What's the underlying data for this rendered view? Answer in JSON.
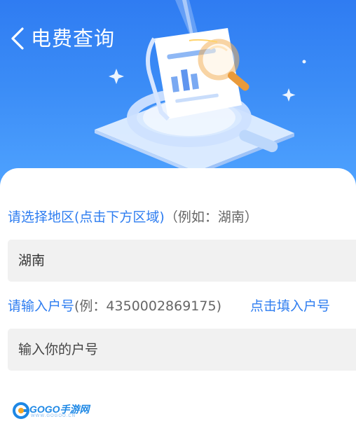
{
  "header": {
    "title": "电费查询",
    "back_icon": "chevron-left-icon",
    "hero_icon": "bill-magnifier-illustration"
  },
  "form": {
    "region_label": "请选择地区(点击下方区域)",
    "region_example": "（例如：湖南）",
    "region_value": "湖南",
    "account_label": "请输入户号",
    "account_example": "(例：4350002869175)",
    "account_fill_link": "点击填入户号",
    "account_placeholder": "输入你的户号"
  },
  "watermark": {
    "brand": "GOGO手游网",
    "url": "WWW.GOGOO.CN"
  },
  "colors": {
    "accent": "#2e7df0",
    "header_top": "#2f7cf2",
    "header_bottom": "#4fa3ff",
    "field_bg": "#f1f1f1"
  }
}
